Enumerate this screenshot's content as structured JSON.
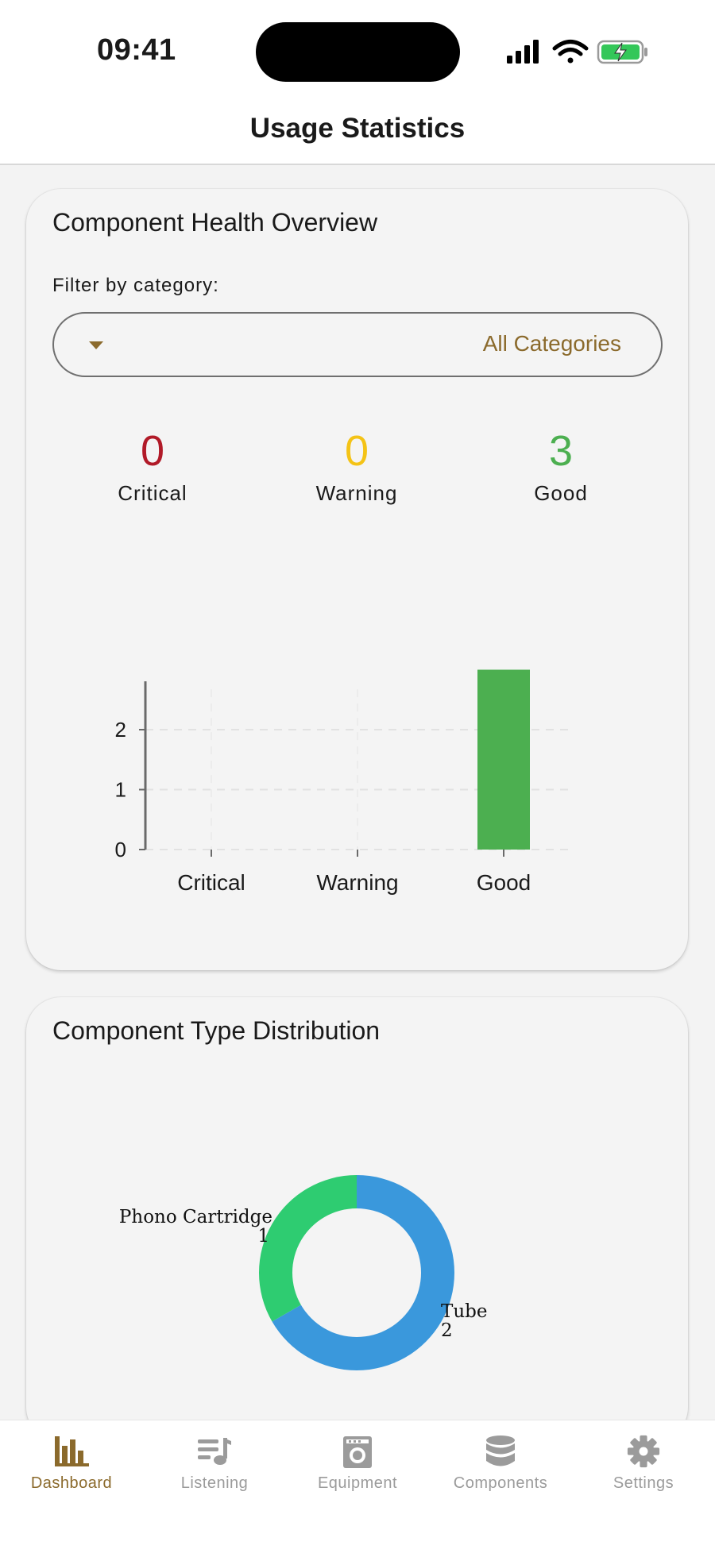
{
  "status_bar": {
    "time": "09:41"
  },
  "header": {
    "title": "Usage Statistics"
  },
  "health_card": {
    "title": "Component Health Overview",
    "filter_label": "Filter by category:",
    "filter_value": "All Categories",
    "stats": [
      {
        "value": "0",
        "label": "Critical",
        "color": "#b11a28"
      },
      {
        "value": "0",
        "label": "Warning",
        "color": "#f4c316"
      },
      {
        "value": "3",
        "label": "Good",
        "color": "#4caf50"
      }
    ]
  },
  "distribution_card": {
    "title": "Component Type Distribution"
  },
  "chart_data": [
    {
      "type": "bar",
      "categories": [
        "Critical",
        "Warning",
        "Good"
      ],
      "values": [
        0,
        0,
        3
      ],
      "colors": [
        "#b11a28",
        "#f4c316",
        "#4caf50"
      ],
      "y_ticks": [
        "0",
        "1",
        "2"
      ],
      "ylim": [
        0,
        3.3
      ],
      "grid": true
    },
    {
      "type": "pie",
      "donut": true,
      "slices": [
        {
          "label": "Tube",
          "value": 2,
          "value_label": "2",
          "color": "#3a98dc"
        },
        {
          "label": "Phono Cartridge",
          "value": 1,
          "value_label": "1",
          "color": "#2ecc71"
        }
      ]
    }
  ],
  "tabbar": {
    "tabs": [
      {
        "label": "Dashboard",
        "icon": "bar-chart-icon",
        "active": true
      },
      {
        "label": "Listening",
        "icon": "playlist-icon",
        "active": false
      },
      {
        "label": "Equipment",
        "icon": "amplifier-icon",
        "active": false
      },
      {
        "label": "Components",
        "icon": "database-icon",
        "active": false
      },
      {
        "label": "Settings",
        "icon": "gear-icon",
        "active": false
      }
    ]
  },
  "colors": {
    "accent": "#8b6a2c",
    "inactive": "#9b9b9b"
  }
}
